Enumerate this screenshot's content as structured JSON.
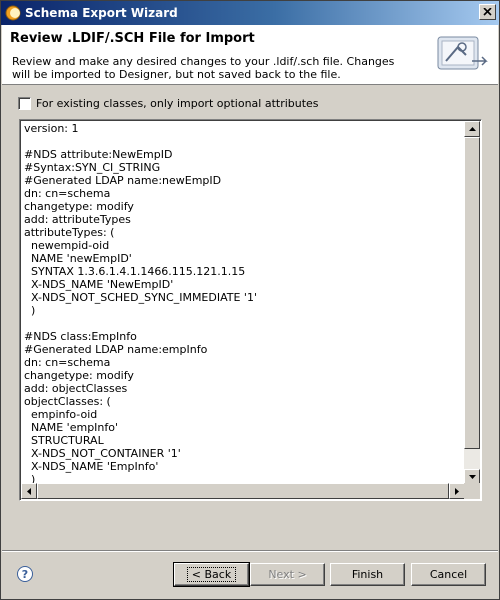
{
  "window": {
    "title": "Schema Export Wizard"
  },
  "header": {
    "title": "Review .LDIF/.SCH File for Import",
    "description": "Review and make any desired changes to your .ldif/.sch file.  Changes will be imported to Designer, but not saved back to the file."
  },
  "options": {
    "optional_attributes_label": "For existing classes, only import optional attributes",
    "optional_attributes_checked": false
  },
  "editor": {
    "lines": [
      "version: 1",
      "",
      "#NDS attribute:NewEmpID",
      "#Syntax:SYN_CI_STRING",
      "#Generated LDAP name:newEmpID",
      "dn: cn=schema",
      "changetype: modify",
      "add: attributeTypes",
      "attributeTypes: (",
      "  newempid-oid",
      "  NAME 'newEmpID'",
      "  SYNTAX 1.3.6.1.4.1.1466.115.121.1.15",
      "  X-NDS_NAME 'NewEmpID'",
      "  X-NDS_NOT_SCHED_SYNC_IMMEDIATE '1'",
      "  )",
      "",
      "#NDS class:EmpInfo",
      "#Generated LDAP name:empInfo",
      "dn: cn=schema",
      "changetype: modify",
      "add: objectClasses",
      "objectClasses: (",
      "  empinfo-oid",
      "  NAME 'empInfo'",
      "  STRUCTURAL",
      "  X-NDS_NOT_CONTAINER '1'",
      "  X-NDS_NAME 'EmpInfo'",
      "  )"
    ]
  },
  "buttons": {
    "help": "?",
    "back": "< Back",
    "next": "Next >",
    "finish": "Finish",
    "cancel": "Cancel"
  },
  "icons": {
    "app": "eclipse-icon",
    "close": "close-icon",
    "header_art": "schema-wizard-icon",
    "help": "help-icon"
  },
  "colors": {
    "title_bar_start": "#0a246a",
    "title_bar_end": "#a6caf0",
    "face": "#d4d0c8"
  }
}
